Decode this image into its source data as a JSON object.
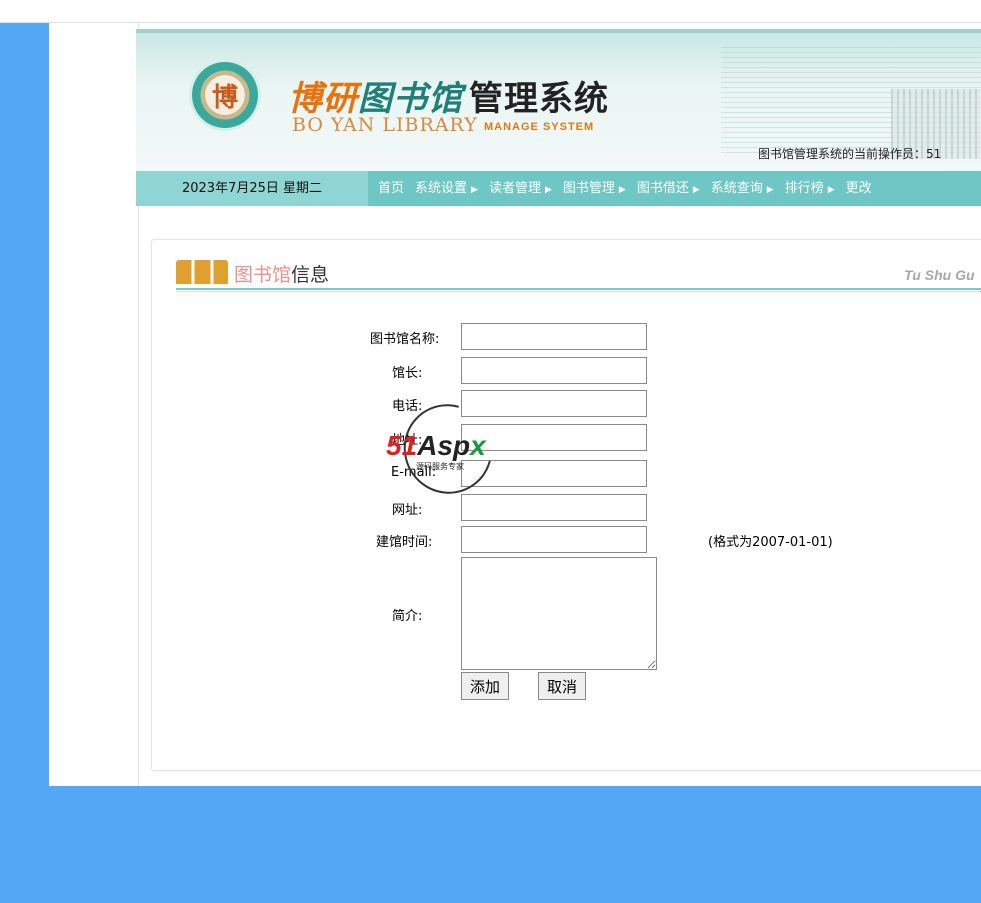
{
  "header": {
    "title_part1": "博研",
    "title_part2": "图书馆",
    "title_part3": "管理系统",
    "logo_char": "博",
    "subtitle_en": "BO YAN LIBRARY",
    "subtitle_en2": "MANAGE SYSTEM",
    "operator_text": "图书馆管理系统的当前操作员：51"
  },
  "nav": {
    "date": "2023年7月25日  星期二",
    "items": [
      {
        "label": "首页",
        "has_arrow": false
      },
      {
        "label": "系统设置",
        "has_arrow": true
      },
      {
        "label": "读者管理",
        "has_arrow": true
      },
      {
        "label": "图书管理",
        "has_arrow": true
      },
      {
        "label": "图书借还",
        "has_arrow": true
      },
      {
        "label": "系统查询",
        "has_arrow": true
      },
      {
        "label": "排行榜",
        "has_arrow": true
      },
      {
        "label": "更改",
        "has_arrow": false
      }
    ],
    "arrow": "▶"
  },
  "section": {
    "title_colored": "图书馆",
    "title_plain": "信息",
    "title_en": "Tu Shu Gu"
  },
  "form": {
    "name_label": "图书馆名称:",
    "curator_label": "馆长:",
    "phone_label": "电话:",
    "address_label": "地址:",
    "email_label": "E-mail:",
    "website_label": "网址:",
    "founded_label": "建馆时间:",
    "founded_hint": "(格式为2007-01-01)",
    "intro_label": "简介:",
    "name_value": "",
    "curator_value": "",
    "phone_value": "",
    "address_value": "",
    "email_value": "",
    "website_value": "",
    "founded_value": "",
    "intro_value": "",
    "add_button": "添加",
    "cancel_button": "取消"
  },
  "watermark": {
    "part_red": "51",
    "part_dark": "Asp",
    "part_green": "x",
    "subtitle": "源码服务专家"
  },
  "colors": {
    "page_bg": "#55a8f5",
    "nav_bg": "#6ec7c4",
    "nav_date_bg": "#8fd5d3",
    "title_orange": "#e8730c",
    "title_teal": "#1f8079"
  }
}
